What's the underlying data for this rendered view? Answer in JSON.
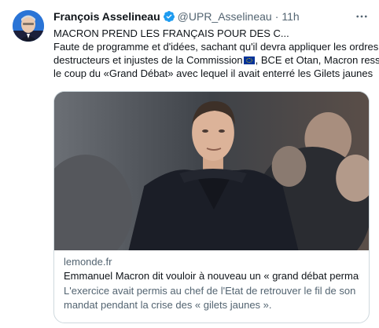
{
  "tweet": {
    "author_name": "François Asselineau",
    "verified_icon": "verified-badge-icon",
    "handle": "@UPR_Asselineau",
    "separator": "·",
    "time": "11h",
    "more_icon": "more-horizontal-icon",
    "text_line1": "MACRON PREND LES FRANÇAIS POUR DES C...",
    "text_line2": "Faute de programme et d'idées, sachant qu'il devra appliquer les ordres",
    "text_line3a": "destructeurs et injustes de la Commission",
    "flag_icon": "eu-flag-icon",
    "text_line3b": ", BCE et Otan, Macron ressort",
    "text_line4": "le coup du «Grand Débat» avec lequel il avait enterré les Gilets jaunes"
  },
  "card": {
    "domain": "lemonde.fr",
    "title": "Emmanuel Macron dit vouloir à nouveau un « grand débat permanent ...",
    "description_line1": "L'exercice avait permis au chef de l'Etat de retrouver le fil de son",
    "description_line2": "mandat pendant la crise des « gilets jaunes »."
  },
  "colors": {
    "verified": "#1d9bf0",
    "secondary_text": "#536471",
    "primary_text": "#0f1419",
    "card_border": "#cfd9de"
  }
}
